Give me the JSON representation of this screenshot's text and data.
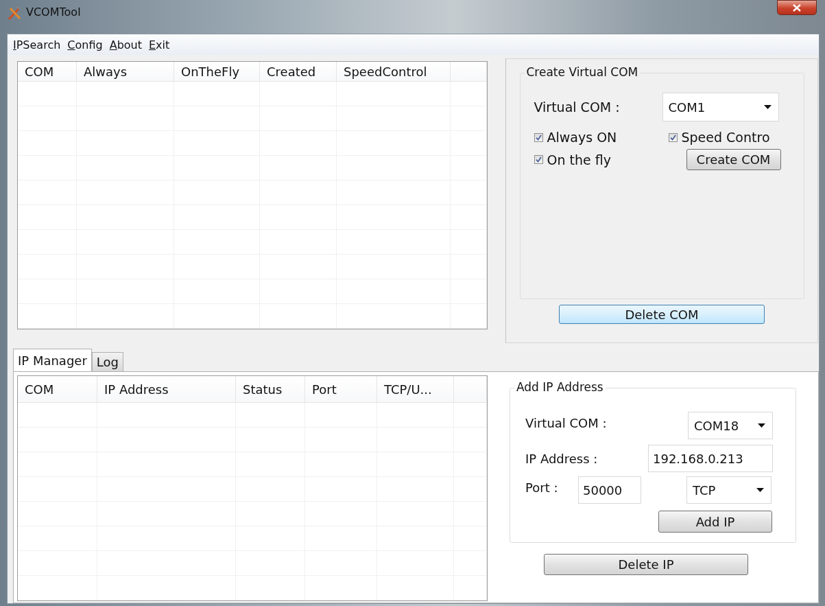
{
  "window": {
    "title": "VCOMTool"
  },
  "menu": [
    {
      "label": "IPSearch"
    },
    {
      "label": "Config"
    },
    {
      "label": "About"
    },
    {
      "label": "Exit"
    }
  ],
  "com_table": {
    "columns": [
      "COM",
      "Always",
      "OnTheFly",
      "Created",
      "SpeedControl"
    ]
  },
  "create_virtual_com": {
    "title": "Create Virtual COM",
    "virtual_com_label": "Virtual COM :",
    "virtual_com": "COM1",
    "options": [
      {
        "label": "Always ON",
        "checked": true
      },
      {
        "label": "Speed Contro",
        "checked": true
      },
      {
        "label": "On the fly",
        "checked": true
      }
    ],
    "create_button": "Create COM",
    "delete_button": "Delete COM"
  },
  "tabs": [
    {
      "label": "IP Manager",
      "selected": true
    },
    {
      "label": "Log",
      "selected": false
    }
  ],
  "ip_table": {
    "columns": [
      "COM",
      "IP Address",
      "Status",
      "Port",
      "TCP/U..."
    ]
  },
  "add_ip_address": {
    "title": "Add IP Address",
    "virtual_com_label": "Virtual COM :",
    "virtual_com": "COM18",
    "ip_label": "IP Address :",
    "ip": "192.168.0.213",
    "port_label": "Port :",
    "port": "50000",
    "protocol": "TCP",
    "add_button": "Add IP",
    "delete_button": "Delete IP"
  }
}
